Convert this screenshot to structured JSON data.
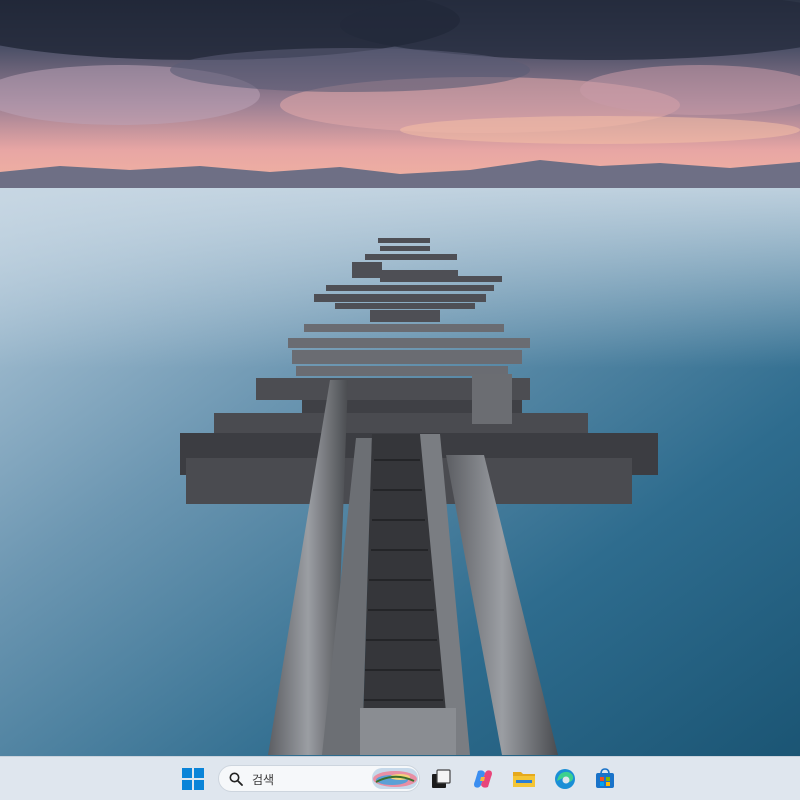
{
  "taskbar": {
    "start_icon": "windows-logo-icon",
    "search": {
      "placeholder": "검색",
      "icon": "magnifier-icon",
      "highlight": "search-highlight-landscape"
    },
    "apps": [
      {
        "name": "task-view",
        "icon": "task-view-icon"
      },
      {
        "name": "copilot",
        "icon": "copilot-icon"
      },
      {
        "name": "file-explorer",
        "icon": "folder-icon"
      },
      {
        "name": "edge",
        "icon": "edge-browser-icon"
      },
      {
        "name": "microsoft-store",
        "icon": "store-bag-icon"
      }
    ]
  },
  "colors": {
    "taskbar_bg": "#dfe6ee",
    "windows_blue": "#0a84d8",
    "folder_yellow": "#f4c534",
    "edge_teal": "#17a2b8",
    "store_blue": "#1a73c9"
  }
}
